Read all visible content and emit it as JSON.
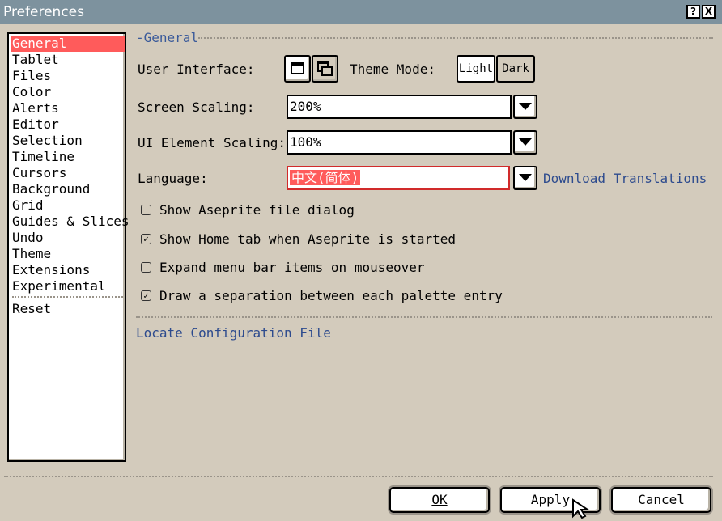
{
  "window": {
    "title": "Preferences",
    "help_glyph": "?",
    "close_glyph": "X"
  },
  "sidebar": {
    "items": [
      {
        "label": "General",
        "active": true
      },
      {
        "label": "Tablet"
      },
      {
        "label": "Files"
      },
      {
        "label": "Color"
      },
      {
        "label": "Alerts"
      },
      {
        "label": "Editor"
      },
      {
        "label": "Selection"
      },
      {
        "label": "Timeline"
      },
      {
        "label": "Cursors"
      },
      {
        "label": "Background"
      },
      {
        "label": "Grid"
      },
      {
        "label": "Guides & Slices"
      },
      {
        "label": "Undo"
      },
      {
        "label": "Theme"
      },
      {
        "label": "Extensions"
      },
      {
        "label": "Experimental"
      }
    ],
    "reset_label": "Reset"
  },
  "general": {
    "group_label": "General",
    "user_interface_label": "User Interface:",
    "theme_mode_label": "Theme Mode:",
    "theme_light": "Light",
    "theme_dark": "Dark",
    "screen_scaling_label": "Screen Scaling:",
    "screen_scaling_value": "200%",
    "ui_element_scaling_label": "UI Element Scaling:",
    "ui_element_scaling_value": "100%",
    "language_label": "Language:",
    "language_value": "中文(简体)",
    "download_translations": "Download Translations",
    "checkboxes": [
      {
        "label": "Show Aseprite file dialog",
        "checked": false
      },
      {
        "label": "Show Home tab when Aseprite is started",
        "checked": true
      },
      {
        "label": "Expand menu bar items on mouseover",
        "checked": false
      },
      {
        "label": "Draw a separation between each palette entry",
        "checked": true
      }
    ],
    "locate_config": "Locate Configuration File"
  },
  "footer": {
    "ok_label": "OK",
    "apply_label": "Apply",
    "cancel_label": "Cancel"
  }
}
